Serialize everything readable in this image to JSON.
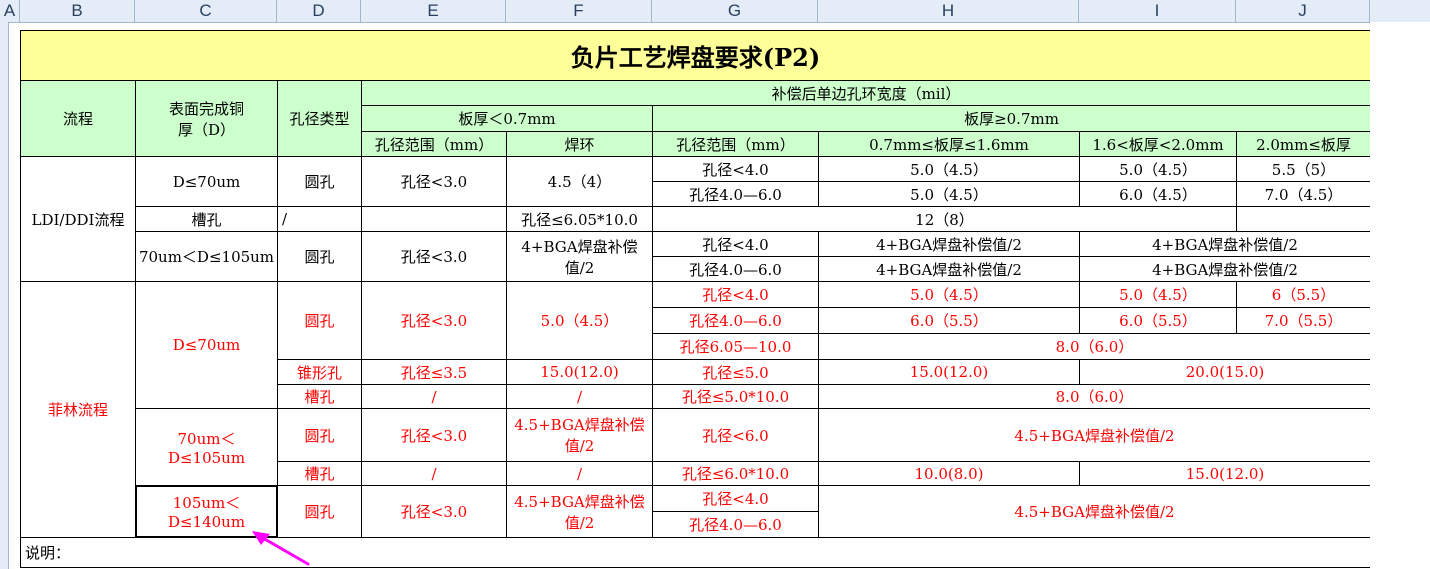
{
  "columns": [
    "A",
    "B",
    "C",
    "D",
    "E",
    "F",
    "G",
    "H",
    "I",
    "J"
  ],
  "title": "负片工艺焊盘要求(P2)",
  "header": {
    "process": "流程",
    "copper": "表面完成铜厚（D）",
    "hole_type": "孔径类型",
    "ring_width": "补偿后单边孔环宽度（mil）",
    "thick_lt": "板厚＜0.7mm",
    "thick_ge": "板厚≥0.7mm",
    "hole_range_1": "孔径范围（mm）",
    "ring": "焊环",
    "hole_range_2": "孔径范围（mm）",
    "t1": "0.7mm≤板厚≤1.6mm",
    "t2": "1.6<板厚<2.0mm",
    "t3": "2.0mm≤板厚"
  },
  "ldi": {
    "process": "LDI/DDI流程",
    "d1": "D≤70um",
    "d2": "70um＜D≤105um",
    "round": "圆孔",
    "slot": "槽孔",
    "r1": {
      "range": "孔径<3.0",
      "ring": "4.5（4）",
      "g": "孔径<4.0",
      "h": "5.0（4.5）",
      "i": "5.0（4.5）",
      "j": "5.5（5）"
    },
    "r2": {
      "g": "孔径4.0—6.0",
      "h": "5.0（4.5）",
      "i": "6.0（4.5）",
      "j": "7.0（4.5）"
    },
    "r3": {
      "range": "/",
      "g": "孔径≤6.05*10.0",
      "hij": "12（8）"
    },
    "r4": {
      "range": "孔径<3.0",
      "ring": "4+BGA焊盘补偿值/2",
      "g": "孔径<4.0",
      "h": "4+BGA焊盘补偿值/2",
      "ij": "4+BGA焊盘补偿值/2"
    },
    "r5": {
      "g": "孔径4.0—6.0",
      "h": "4+BGA焊盘补偿值/2",
      "ij": "4+BGA焊盘补偿值/2"
    }
  },
  "feilin": {
    "process": "菲林流程",
    "d1": "D≤70um",
    "d2": "70um＜D≤105um",
    "d3": "105um＜D≤140um",
    "round": "圆孔",
    "cone": "锥形孔",
    "slot": "槽孔",
    "r1": {
      "range": "孔径<3.0",
      "ring": "5.0（4.5）",
      "g": "孔径<4.0",
      "h": "5.0（4.5）",
      "i": "5.0（4.5）",
      "j": "6（5.5）"
    },
    "r2": {
      "g": "孔径4.0—6.0",
      "h": "6.0（5.5）",
      "i": "6.0（5.5）",
      "j": "7.0（5.5）"
    },
    "r3": {
      "g": "孔径6.05—10.0",
      "hij": "8.0（6.0）"
    },
    "r4": {
      "range": "孔径≤3.5",
      "ring": "15.0(12.0)",
      "g": "孔径≤5.0",
      "h": "15.0(12.0)",
      "ij": "20.0(15.0)"
    },
    "r5": {
      "range": "/",
      "ring": "/",
      "g": "孔径≤5.0*10.0",
      "hij": "8.0（6.0）"
    },
    "r6": {
      "range": "孔径<3.0",
      "ring": "4.5+BGA焊盘补偿值/2",
      "g": "孔径<6.0",
      "hij": "4.5+BGA焊盘补偿值/2"
    },
    "r7": {
      "range": "/",
      "ring": "/",
      "g": "孔径≤6.0*10.0",
      "h": "10.0(8.0)",
      "ij": "15.0(12.0)"
    },
    "r8": {
      "range": "孔径<3.0",
      "ring": "4.5+BGA焊盘补偿值/2",
      "g": "孔径<4.0",
      "hij": "4.5+BGA焊盘补偿值/2"
    },
    "r9": {
      "g": "孔径4.0—6.0"
    }
  },
  "note": "说明：",
  "colors": {
    "title_bg": "#ffff99",
    "header_bg": "#ccffcc",
    "red_text": "#ff0000",
    "arrow": "#ff00ff"
  }
}
